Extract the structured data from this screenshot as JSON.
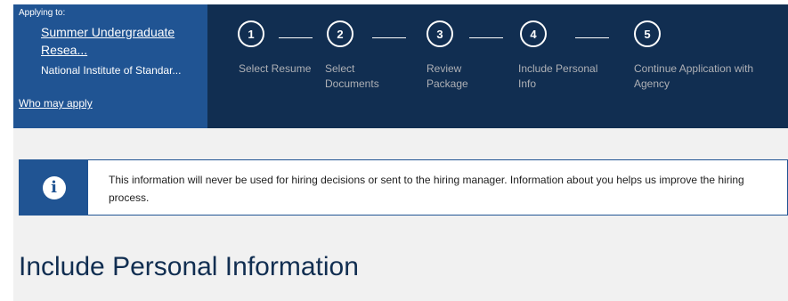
{
  "applying": {
    "label": "Applying to:",
    "job_title": "Summer Undergraduate Resea...",
    "agency": "National Institute of Standar...",
    "who_may_apply": "Who may apply"
  },
  "steps": [
    {
      "number": "1",
      "label": "Select Resume"
    },
    {
      "number": "2",
      "label": "Select Documents"
    },
    {
      "number": "3",
      "label": "Review Package"
    },
    {
      "number": "4",
      "label": "Include Personal Info"
    },
    {
      "number": "5",
      "label": "Continue Application with Agency"
    }
  ],
  "alert": {
    "icon": "info-icon",
    "text": "This information will never be used for hiring decisions or sent to the hiring manager. Information about you helps us improve the hiring process."
  },
  "page": {
    "title": "Include Personal Information"
  },
  "colors": {
    "header_dark": "#112e51",
    "header_blue": "#205493",
    "background_gray": "#f1f1f1",
    "step_label": "#aeb0b5"
  }
}
